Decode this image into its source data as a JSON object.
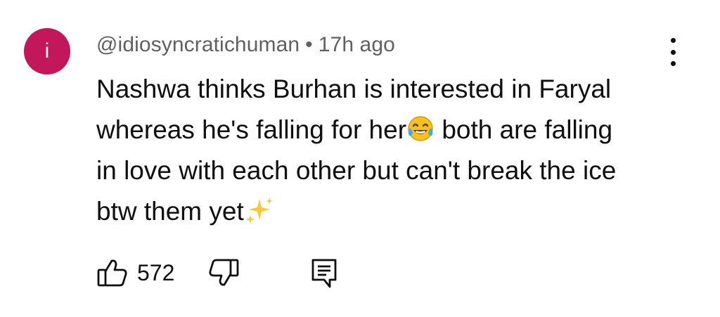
{
  "comment": {
    "avatar_initial": "i",
    "avatar_color": "#c2185b",
    "author": "@idiosyncratichuman",
    "separator": "•",
    "time": "17h ago",
    "text_lines": [
      "Nashwa thinks Burhan is interested in Faryal",
      "whereas he's falling for her",
      "both are falling",
      "in love with each other but can't break the ice",
      "btw them yet"
    ],
    "emojis": [
      "face-with-tears-of-joy-icon",
      "sparkles-icon"
    ],
    "like_count": "572"
  },
  "icons": {
    "like": "thumbs-up-icon",
    "dislike": "thumbs-down-icon",
    "reply": "comment-reply-icon",
    "more": "more-vertical-icon"
  }
}
